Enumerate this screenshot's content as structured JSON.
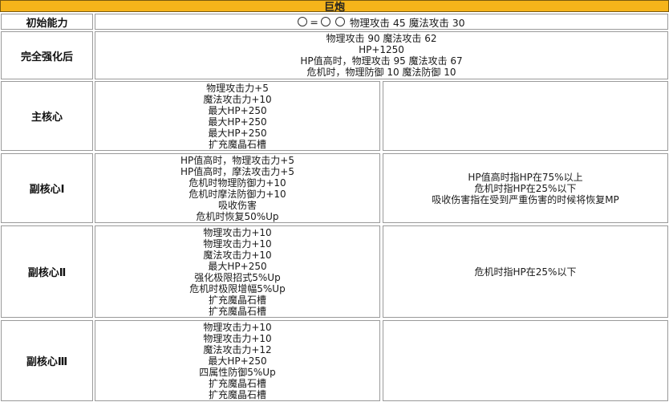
{
  "title": "巨炮",
  "initial": {
    "label": "初始能力",
    "equals": "=",
    "text": "物理攻击 45 魔法攻击 30"
  },
  "full": {
    "label": "完全强化后",
    "lines": [
      "物理攻击 90 魔法攻击 62",
      "HP+1250",
      "HP值高时，物理攻击 95 魔法攻击 67",
      "危机时，物理防御 10 魔法防御 10"
    ]
  },
  "rows": [
    {
      "label": "主核心",
      "effects": [
        "物理攻击力+5",
        "魔法攻击力+10",
        "最大HP+250",
        "最大HP+250",
        "最大HP+250",
        "扩充魔晶石槽"
      ],
      "notes": []
    },
    {
      "label": "副核心Ⅰ",
      "effects": [
        "HP值高时，物理攻击力+5",
        "HP值高时，摩法攻击力+5",
        "危机时物理防御力+10",
        "危机时摩法防御力+10",
        "吸收伤害",
        "危机时恢复50%Up"
      ],
      "notes": [
        "HP值高时指HP在75%以上",
        "危机时指HP在25%以下",
        "吸收伤害指在受到严重伤害的时候将恢复MP"
      ]
    },
    {
      "label": "副核心Ⅱ",
      "effects": [
        "物理攻击力+10",
        "物理攻击力+10",
        "魔法攻击力+10",
        "最大HP+250",
        "强化极限招式5%Up",
        "危机时极限增幅5%Up",
        "扩充魔晶石槽",
        "扩充魔晶石槽"
      ],
      "notes": [
        "危机时指HP在25%以下"
      ]
    },
    {
      "label": "副核心Ⅲ",
      "effects": [
        "物理攻击力+10",
        "物理攻击力+10",
        "魔法攻击力+12",
        "最大HP+250",
        "四属性防御5%Up",
        "扩充魔晶石槽",
        "扩充魔晶石槽"
      ],
      "notes": []
    }
  ]
}
